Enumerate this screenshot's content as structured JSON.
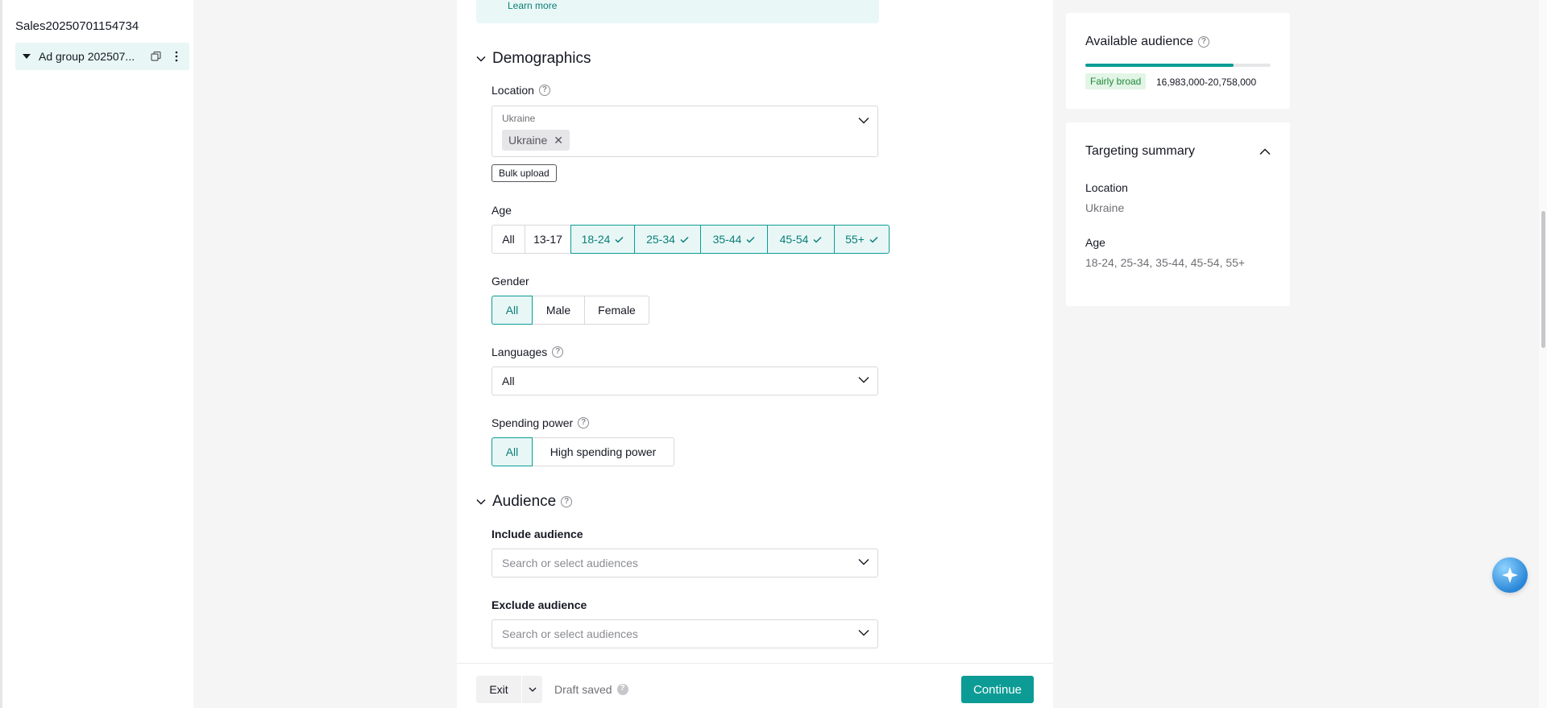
{
  "sidebar": {
    "campaign_name": "Sales20250701154734",
    "adgroup_label": "Ad group 202507..."
  },
  "main": {
    "learn_more": "Learn more",
    "demographics_title": "Demographics",
    "location": {
      "label": "Location",
      "placeholder": "Ukraine",
      "tags": [
        "Ukraine"
      ],
      "bulk_upload": "Bulk upload"
    },
    "age": {
      "label": "Age",
      "options": [
        {
          "label": "All",
          "selected": false
        },
        {
          "label": "13-17",
          "selected": false
        },
        {
          "label": "18-24",
          "selected": true
        },
        {
          "label": "25-34",
          "selected": true
        },
        {
          "label": "35-44",
          "selected": true
        },
        {
          "label": "45-54",
          "selected": true
        },
        {
          "label": "55+",
          "selected": true
        }
      ]
    },
    "gender": {
      "label": "Gender",
      "options": [
        {
          "label": "All",
          "selected": true
        },
        {
          "label": "Male",
          "selected": false
        },
        {
          "label": "Female",
          "selected": false
        }
      ]
    },
    "languages": {
      "label": "Languages",
      "value": "All"
    },
    "spending_power": {
      "label": "Spending power",
      "options": [
        {
          "label": "All",
          "selected": true
        },
        {
          "label": "High spending power",
          "selected": false
        }
      ]
    },
    "audience_title": "Audience",
    "include_audience": {
      "label": "Include audience",
      "placeholder": "Search or select audiences"
    },
    "exclude_audience": {
      "label": "Exclude audience",
      "placeholder": "Search or select audiences"
    }
  },
  "bottombar": {
    "exit": "Exit",
    "draft_status": "Draft saved",
    "continue": "Continue"
  },
  "available_audience": {
    "title": "Available audience",
    "breadth_label": "Fairly broad",
    "breadth_level": 0.8,
    "range": "16,983,000-20,758,000"
  },
  "targeting_summary": {
    "title": "Targeting summary",
    "location_label": "Location",
    "location_value": "Ukraine",
    "age_label": "Age",
    "age_value": "18-24, 25-34, 35-44, 45-54, 55+"
  },
  "colors": {
    "accent": "#0c9c95",
    "accent_bg": "#e8f7f6",
    "badge_bg": "#e3f5e6",
    "badge_text": "#1f8a3a"
  }
}
